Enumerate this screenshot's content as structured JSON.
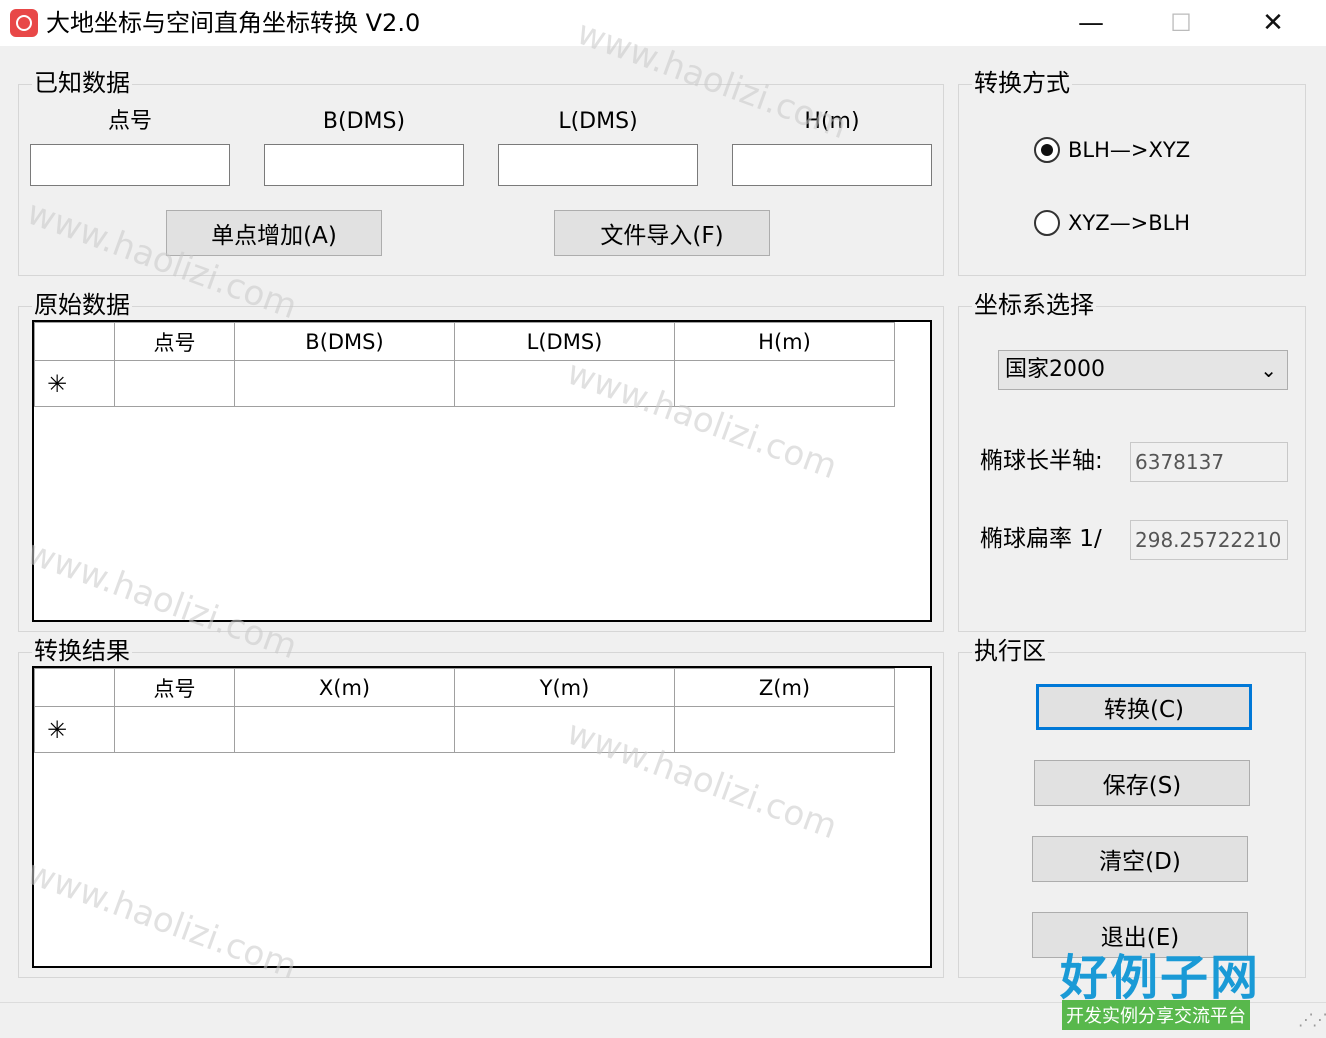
{
  "window": {
    "title": "大地坐标与空间直角坐标转换 V2.0",
    "minimize": "—",
    "maximize": "☐",
    "close": "✕"
  },
  "known": {
    "group_label": "已知数据",
    "col_point": "点号",
    "col_b": "B(DMS)",
    "col_l": "L(DMS)",
    "col_h": "H(m)",
    "values": {
      "point": "",
      "b": "",
      "l": "",
      "h": ""
    },
    "add_button": "单点增加(A)",
    "import_button": "文件导入(F)"
  },
  "original": {
    "group_label": "原始数据",
    "columns": [
      "点号",
      "B(DMS)",
      "L(DMS)",
      "H(m)"
    ],
    "new_row_marker": "✳"
  },
  "result": {
    "group_label": "转换结果",
    "columns": [
      "点号",
      "X(m)",
      "Y(m)",
      "Z(m)"
    ],
    "new_row_marker": "✳"
  },
  "mode": {
    "group_label": "转换方式",
    "options": [
      {
        "label": "BLH—>XYZ",
        "selected": true
      },
      {
        "label": "XYZ—>BLH",
        "selected": false
      }
    ]
  },
  "coord_system": {
    "group_label": "坐标系选择",
    "selected": "国家2000",
    "semi_major_label": "椭球长半轴:",
    "semi_major_value": "6378137",
    "flattening_label": "椭球扁率 1/",
    "flattening_value": "298.25722210"
  },
  "exec": {
    "group_label": "执行区",
    "convert": "转换(C)",
    "save": "保存(S)",
    "clear": "清空(D)",
    "exit": "退出(E)"
  },
  "watermark_text": "www.haolizi.com",
  "logo": {
    "main": "好例子网",
    "sub": "开发实例分享交流平台"
  },
  "colors": {
    "accent": "#0078d7",
    "logo_blue": "#1a9ad6",
    "logo_green": "#58b84c"
  }
}
